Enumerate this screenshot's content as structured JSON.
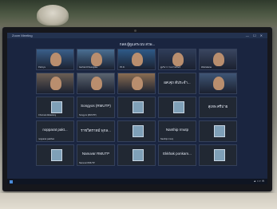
{
  "window": {
    "app_title": "Zoom Meeting",
    "controls": "— ☐ ✕"
  },
  "meeting": {
    "banner": "กลส.ผู้ดูแลระบบ สวพ..."
  },
  "colors": {
    "screen_bg": "#1a2540",
    "tile_bg": "#212833"
  },
  "tiles": [
    {
      "kind": "video",
      "label": "Parinya",
      "tone": "#3a5f8a"
    },
    {
      "kind": "video",
      "label": "Gerhard Fhuengdee",
      "tone": "#4a6f93"
    },
    {
      "kind": "video",
      "label": "Ph.D.",
      "tone": "#2e5a88"
    },
    {
      "kind": "video",
      "label": "ผู้บริหาร กรมราชทัณฑ์",
      "tone": "#2f3d59"
    },
    {
      "kind": "video",
      "label": "Wanlukana",
      "tone": "#3a4660"
    },
    {
      "kind": "video",
      "label": "",
      "tone": "#6b5e54"
    },
    {
      "kind": "video",
      "label": "",
      "tone": "#5b6470"
    },
    {
      "kind": "video",
      "label": "",
      "tone": "#8a6c52"
    },
    {
      "kind": "text",
      "name": "ผศ.ศุภ ดีประจำ...",
      "label": "",
      "tone": "#212833"
    },
    {
      "kind": "video",
      "label": "",
      "tone": "#3f5575"
    },
    {
      "kind": "avatar",
      "label": "Chonnat Akkawong",
      "tone": "#212833"
    },
    {
      "kind": "text",
      "name": "Songyos (RMUTP)",
      "label": "Songyos (RMUTP)",
      "tone": "#212833"
    },
    {
      "kind": "avatar",
      "label": "",
      "tone": "#212833"
    },
    {
      "kind": "avatar",
      "label": "",
      "tone": "#212833"
    },
    {
      "kind": "text",
      "name": "สุเทพ ศรีบ่าย",
      "label": "",
      "tone": "#212833"
    },
    {
      "kind": "text",
      "name": "nopparat pakt...",
      "label": "nopparat pakthan",
      "tone": "#212833"
    },
    {
      "kind": "text",
      "name": "ราชวิตราหม์ พุกล...",
      "label": "",
      "tone": "#212833"
    },
    {
      "kind": "avatar",
      "label": "",
      "tone": "#212833"
    },
    {
      "kind": "text",
      "name": "Nanthip rmutp",
      "label": "Nanthip rmutp",
      "tone": "#212833"
    },
    {
      "kind": "avatar",
      "label": "",
      "tone": "#212833"
    },
    {
      "kind": "avatar",
      "label": "",
      "tone": "#212833"
    },
    {
      "kind": "text",
      "name": "Nanuvar RMUTP",
      "label": "Nanuvar RMUTP",
      "tone": "#212833"
    },
    {
      "kind": "avatar",
      "label": "",
      "tone": "#212833"
    },
    {
      "kind": "text",
      "name": "Ekkhak ponkam...",
      "label": "",
      "tone": "#212833"
    },
    {
      "kind": "avatar",
      "label": "",
      "tone": "#212833"
    }
  ]
}
